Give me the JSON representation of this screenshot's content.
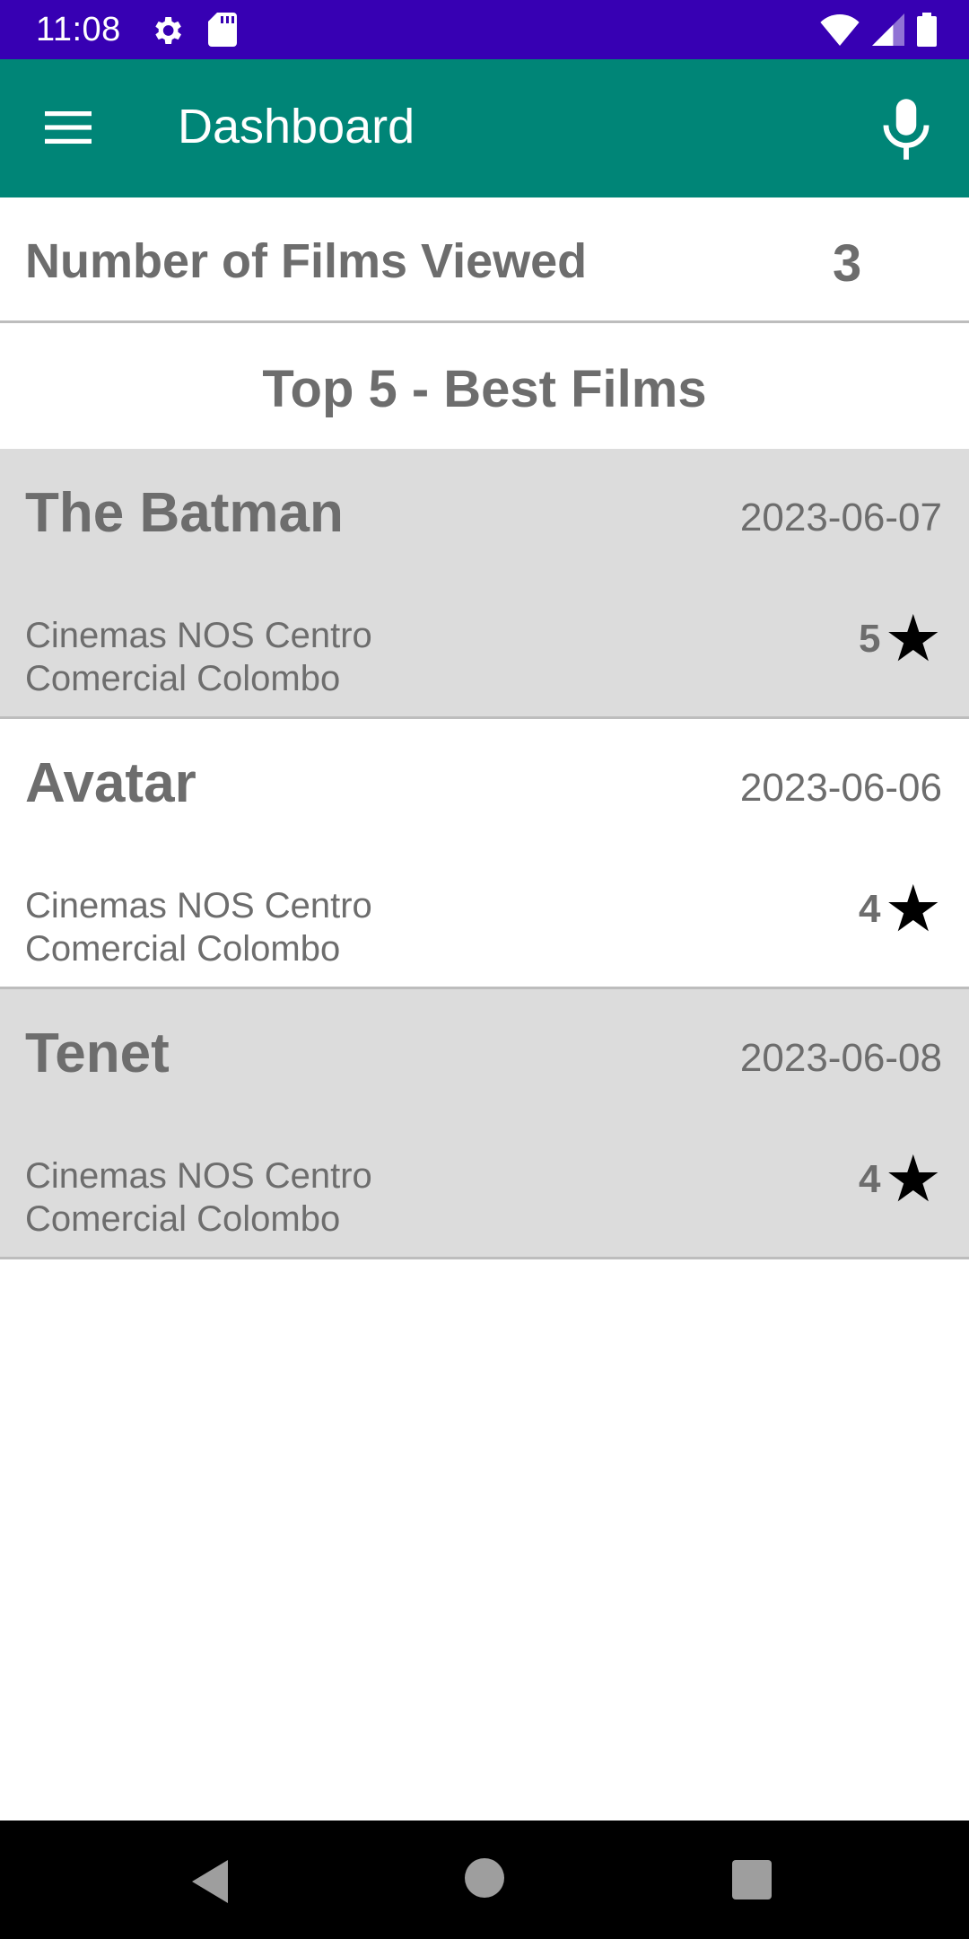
{
  "status_bar": {
    "time": "11:08",
    "icons": [
      "settings-gear-icon",
      "sd-card-icon",
      "wifi-icon",
      "cell-signal-icon",
      "battery-icon"
    ]
  },
  "app_bar": {
    "title": "Dashboard",
    "menu_icon": "hamburger-menu-icon",
    "action_icon": "microphone-icon",
    "color": "#008577"
  },
  "summary": {
    "label": "Number of Films Viewed",
    "count": "3"
  },
  "section": {
    "title": "Top 5 - Best Films"
  },
  "films": [
    {
      "title": "The Batman",
      "date": "2023-06-07",
      "cinema": "Cinemas NOS Centro Comercial Colombo",
      "rating": "5",
      "rating_icon": "star-icon"
    },
    {
      "title": "Avatar",
      "date": "2023-06-06",
      "cinema": "Cinemas NOS Centro Comercial Colombo",
      "rating": "4",
      "rating_icon": "star-icon"
    },
    {
      "title": "Tenet",
      "date": "2023-06-08",
      "cinema": "Cinemas NOS Centro Comercial Colombo",
      "rating": "4",
      "rating_icon": "star-icon"
    }
  ],
  "nav_bar": {
    "buttons": [
      "back-icon",
      "home-icon",
      "recents-icon"
    ]
  },
  "colors": {
    "status_bar": "#3700b3",
    "app_bar": "#008577",
    "card_alt_bg": "#dcdcdc",
    "text_gray": "#6d6d6d"
  }
}
